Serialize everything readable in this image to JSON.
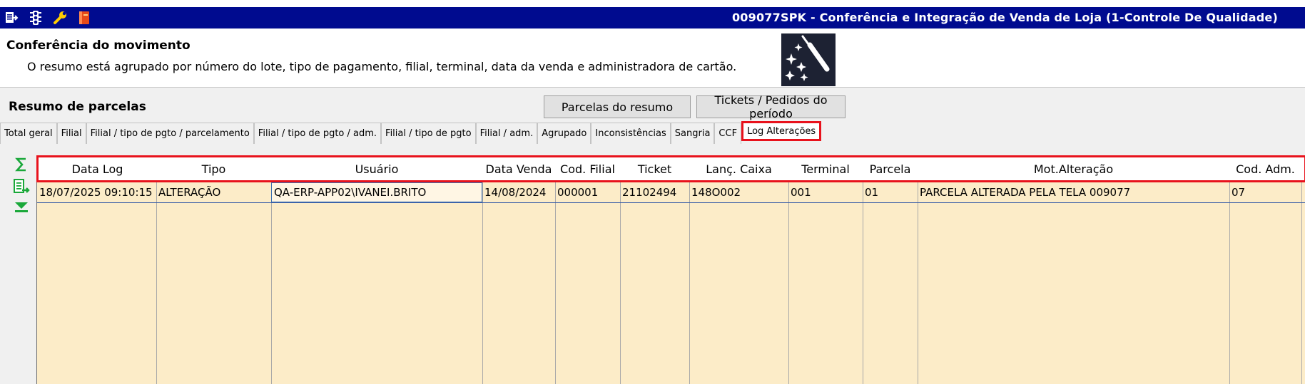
{
  "window": {
    "title": "009077SPK - Conferência e Integração de Venda de Loja (1-Controle De Qualidade)",
    "toolbar_icons": [
      "exit-icon",
      "traffic-light-icon",
      "wrench-icon",
      "book-icon"
    ]
  },
  "header": {
    "title": "Conferência do movimento",
    "subtitle": "O resumo está agrupado por número do lote, tipo de pagamento, filial, terminal, data da venda e administradora de cartão.",
    "icon": "magic-wand-icon"
  },
  "resumo": {
    "title": "Resumo de parcelas",
    "btn_parcelas": "Parcelas do resumo",
    "btn_tickets": "Tickets / Pedidos do período"
  },
  "tabs": [
    {
      "label": "Total geral"
    },
    {
      "label": "Filial"
    },
    {
      "label": "Filial / tipo de pgto / parcelamento"
    },
    {
      "label": "Filial / tipo de pgto / adm."
    },
    {
      "label": "Filial / tipo de pgto"
    },
    {
      "label": "Filial / adm."
    },
    {
      "label": "Agrupado"
    },
    {
      "label": "Inconsistências"
    },
    {
      "label": "Sangria"
    },
    {
      "label": "CCF"
    },
    {
      "label": "Log Alterações",
      "active": true
    }
  ],
  "side_icons": [
    "sum-icon",
    "export-icon",
    "expand-down-icon"
  ],
  "grid": {
    "columns": [
      "Data Log",
      "Tipo",
      "Usuário",
      "Data Venda",
      "Cod. Filial",
      "Ticket",
      "Lanç. Caixa",
      "Terminal",
      "Parcela",
      "Mot.Alteração",
      "Cod. Adm."
    ],
    "rows": [
      [
        "18/07/2025 09:10:15",
        "ALTERAÇÃO",
        "QA-ERP-APP02\\IVANEI.BRITO",
        "14/08/2024",
        "000001",
        "21102494",
        "148O002",
        "001",
        "01",
        "PARCELA ALTERADA PELA TELA 009077",
        "07"
      ]
    ]
  },
  "colors": {
    "titlebar": "#000b8f",
    "highlight": "#e8121c",
    "grid_bg": "#fcecc8"
  }
}
